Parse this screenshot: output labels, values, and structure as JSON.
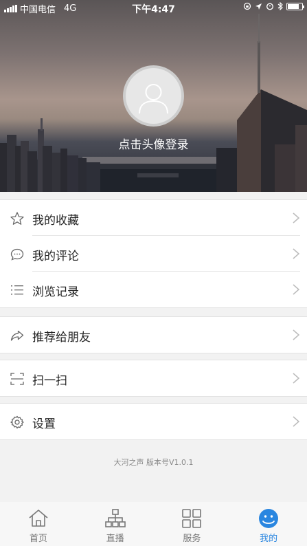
{
  "status_bar": {
    "carrier": "中国电信",
    "network": "4G",
    "time": "下午4:47"
  },
  "profile": {
    "login_prompt": "点击头像登录"
  },
  "menu": {
    "favorites": "我的收藏",
    "comments": "我的评论",
    "history": "浏览记录",
    "recommend": "推荐给朋友",
    "scan": "扫一扫",
    "settings": "设置"
  },
  "version_text": "大河之声  版本号V1.0.1",
  "tabs": [
    {
      "label": "首页",
      "icon": "home-icon"
    },
    {
      "label": "直播",
      "icon": "live-icon"
    },
    {
      "label": "服务",
      "icon": "grid-icon"
    },
    {
      "label": "我的",
      "icon": "profile-icon"
    }
  ],
  "colors": {
    "accent": "#2a86e0",
    "tab_inactive": "#777777",
    "page_bg": "#f2f2f2"
  }
}
